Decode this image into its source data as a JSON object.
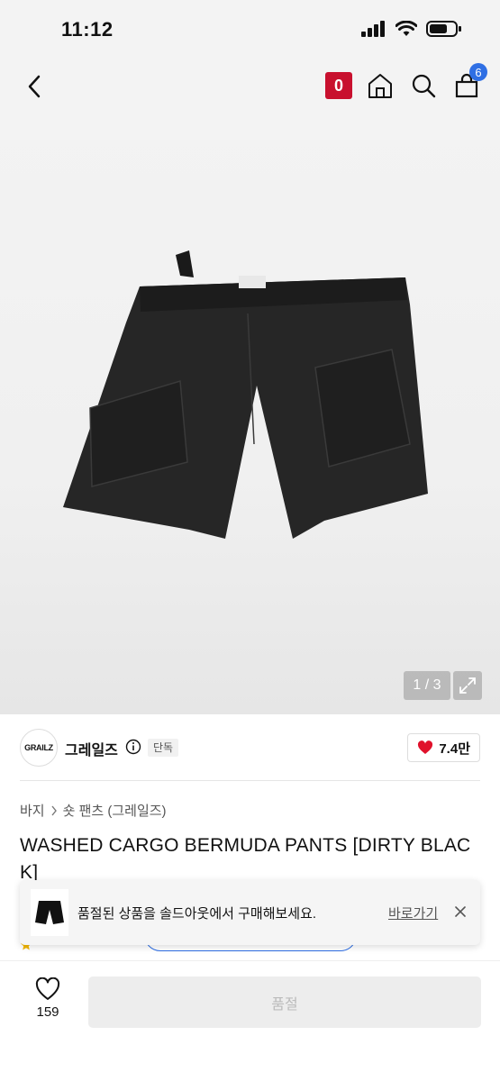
{
  "status_bar": {
    "time": "11:12"
  },
  "nav": {
    "point_badge": "0",
    "cart_count": "6"
  },
  "gallery": {
    "page_indicator": "1 / 3"
  },
  "brand": {
    "logo_text": "GRAILZ",
    "name": "그레일즈",
    "tag": "단독",
    "likes": "7.4만"
  },
  "breadcrumb": {
    "level1": "바지",
    "level2": "숏 팬츠 (그레일즈)"
  },
  "product": {
    "title": "WASHED CARGO BERMUDA PANTS [DIRTY BLACK]"
  },
  "toast": {
    "message": "품절된 상품을 솔드아웃에서 구매해보세요.",
    "link_label": "바로가기"
  },
  "bottom": {
    "wish_count": "159",
    "soldout_label": "품절"
  },
  "colors": {
    "brand_red": "#c8102e",
    "cart_blue": "#2f6fe4",
    "heart_red": "#e0112b"
  },
  "icons": [
    "back-arrow-icon",
    "home-icon",
    "search-icon",
    "cart-icon",
    "expand-icon",
    "info-icon",
    "heart-icon",
    "close-icon"
  ]
}
